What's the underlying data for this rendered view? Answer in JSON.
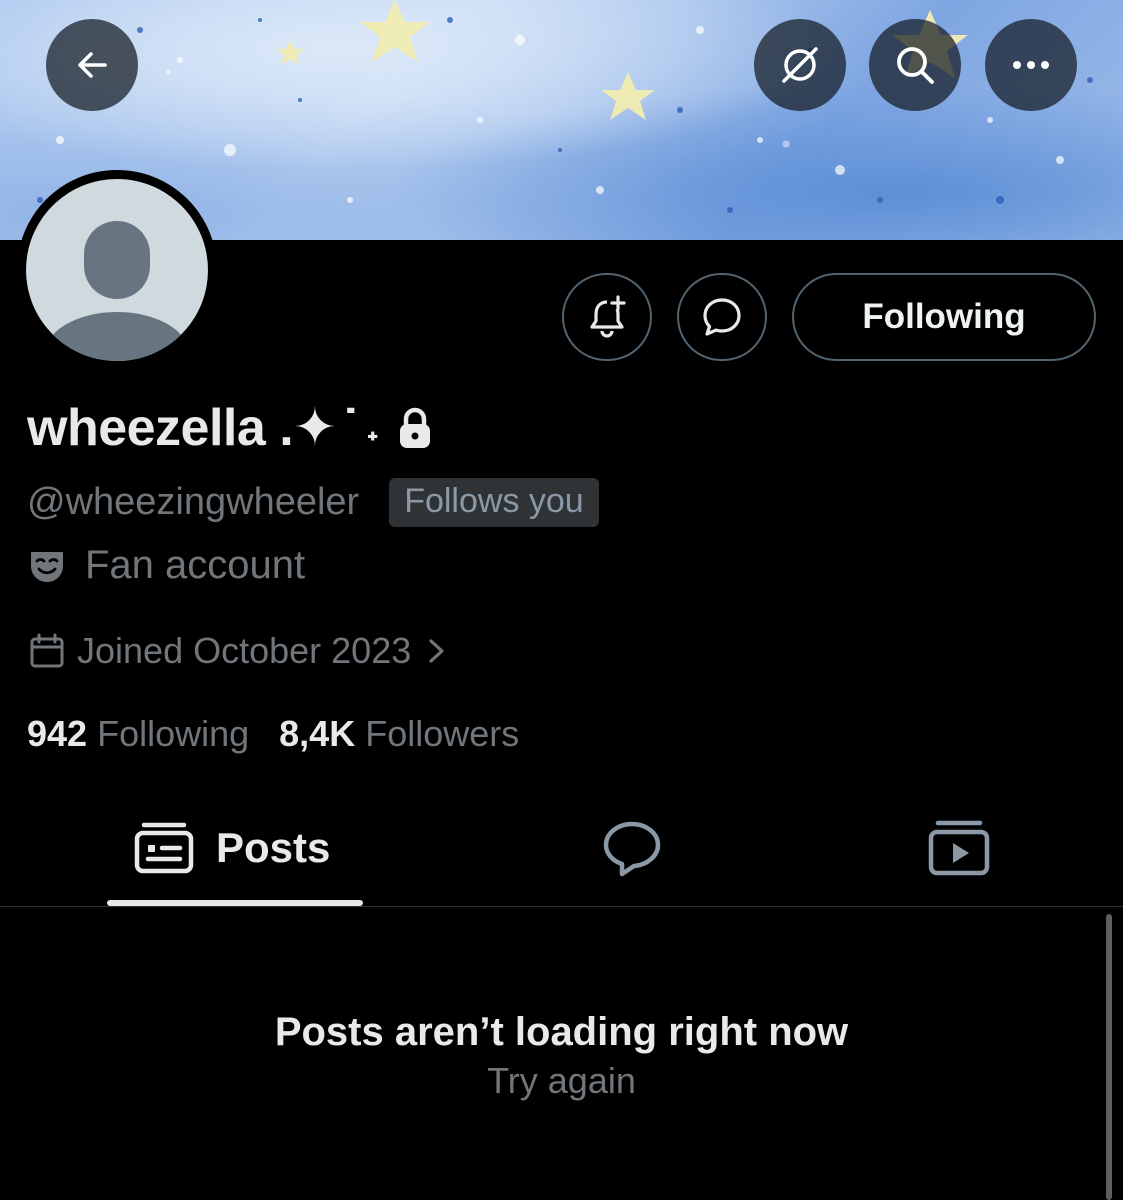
{
  "profile": {
    "display_name": "wheezella .✦ ̇ ˖",
    "handle": "@wheezingwheeler",
    "follows_you": "Follows you",
    "category": "Fan account",
    "joined": "Joined October 2023",
    "following_count": "942",
    "following_label": "Following",
    "followers_count": "8,4K",
    "followers_label": "Followers"
  },
  "actions": {
    "follow_state": "Following"
  },
  "tabs": [
    {
      "label": "Posts",
      "icon": "posts-icon",
      "selected": true
    },
    {
      "label": "",
      "icon": "replies-icon",
      "selected": false
    },
    {
      "label": "",
      "icon": "media-icon",
      "selected": false
    }
  ],
  "feed": {
    "empty_title": "Posts aren’t loading right now",
    "retry": "Try again"
  },
  "icons": {
    "back": "back-arrow-icon",
    "grok": "grok-icon",
    "search": "search-icon",
    "more": "more-icon",
    "notify": "bell-plus-icon",
    "message": "message-icon",
    "lock": "lock-icon",
    "category": "theater-masks-icon",
    "calendar": "calendar-icon"
  },
  "colors": {
    "background": "#000000",
    "text_primary": "#e7e9ea",
    "text_secondary": "#71767b",
    "border": "#536471"
  }
}
